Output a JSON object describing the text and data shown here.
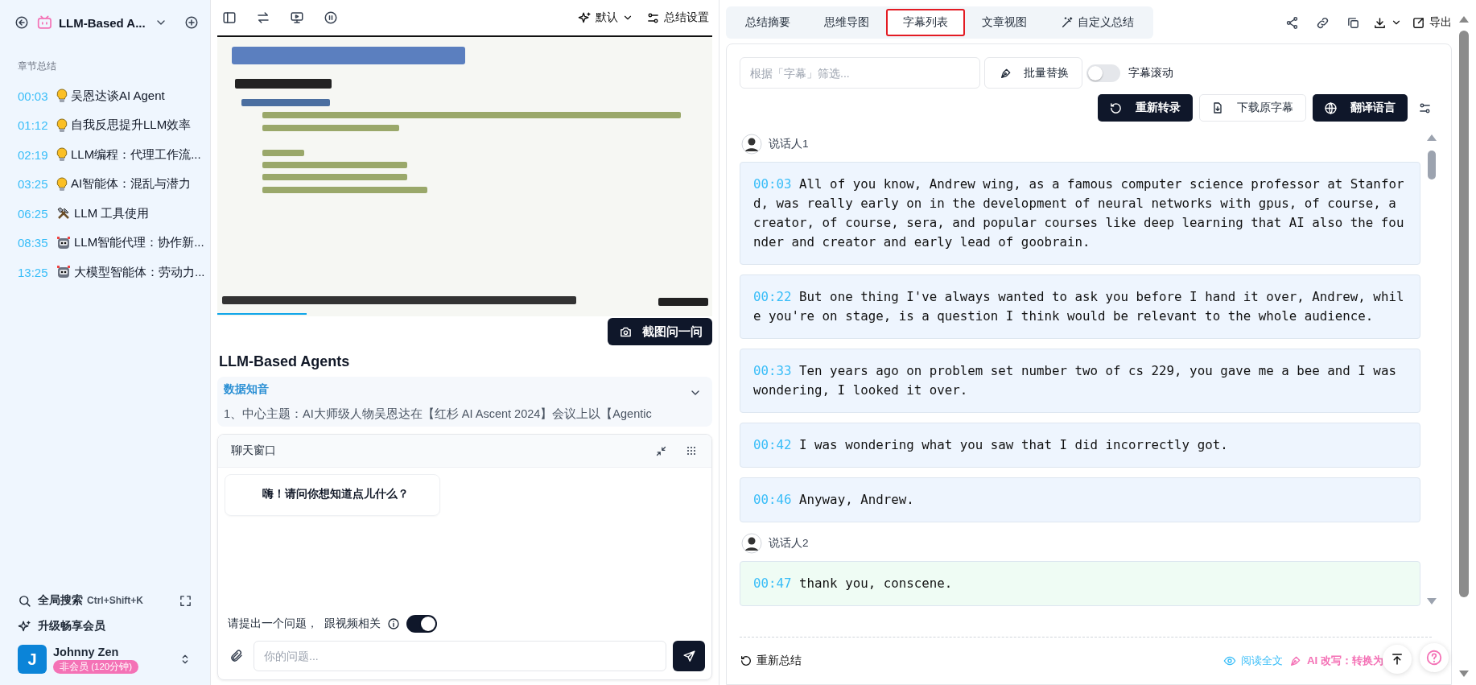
{
  "sidebar": {
    "title": "LLM-Based A...",
    "section_label": "章节总结",
    "chapters": [
      {
        "time": "00:03",
        "kind": "bulb",
        "title": "吴恩达谈AI Agent"
      },
      {
        "time": "01:12",
        "kind": "bulb",
        "title": "自我反思提升LLM效率"
      },
      {
        "time": "02:19",
        "kind": "bulb",
        "title": "LLM编程：代理工作流..."
      },
      {
        "time": "03:25",
        "kind": "bulb",
        "title": "AI智能体：混乱与潜力"
      },
      {
        "time": "06:25",
        "kind": "tools",
        "title": "LLM 工具使用"
      },
      {
        "time": "08:35",
        "kind": "robot",
        "title": "LLM智能代理：协作新..."
      },
      {
        "time": "13:25",
        "kind": "robot",
        "title": "大模型智能体：劳动力..."
      }
    ],
    "search": {
      "label": "全局搜索",
      "shortcut": "Ctrl+Shift+K"
    },
    "upgrade": "升级畅享会员",
    "user": {
      "initial": "J",
      "name": "Johnny Zen",
      "badge": "非会员 (120分钟)"
    }
  },
  "player": {
    "mode": "默认",
    "settings": "总结设置",
    "video": {
      "kind": "picture",
      "level": 0.18
    },
    "screenshot_button": "截图问一问"
  },
  "summary": {
    "title": "LLM-Based Agents",
    "source": "数据知音",
    "text": "1、中心主题：AI大师级人物吴恩达在【红杉 AI Ascent 2024】会议上以【Agentic"
  },
  "chat": {
    "title": "聊天窗口",
    "greeting": "嗨！请问你想知道点儿什么？",
    "hint": "请提出一个问题，",
    "related_label": "跟视频相关",
    "related_on": true,
    "placeholder": "你的问题..."
  },
  "tabs": [
    {
      "label": "总结摘要",
      "kind": "text",
      "selected": false
    },
    {
      "label": "思维导图",
      "kind": "text",
      "selected": false
    },
    {
      "label": "字幕列表",
      "kind": "text",
      "selected": true
    },
    {
      "label": "文章视图",
      "kind": "text",
      "selected": false
    },
    {
      "label": "自定义总结",
      "kind": "tool",
      "selected": false
    }
  ],
  "export_label": "导出",
  "filter": {
    "placeholder": "根据「字幕」筛选...",
    "replace_button": "批量替换",
    "scroll_label": "字幕滚动",
    "scroll_on": false
  },
  "actions": [
    {
      "label": "重新转录",
      "kind": "primary"
    },
    {
      "label": "下载原字幕",
      "kind": "outline"
    },
    {
      "label": "翻译语言",
      "kind": "primary"
    }
  ],
  "transcript": [
    {
      "speaker": "说话人1",
      "color": "#eef5fe",
      "segments": [
        {
          "time": "00:03",
          "text": "All of you know, Andrew wing, as a famous computer science professor at Stanford, was really early on in the development of neural networks with gpus, of course, a creator, of course, sera, and popular courses like deep learning that AI also the founder and creator and early lead of goobrain."
        },
        {
          "time": "00:22",
          "text": "But one thing I've always wanted to ask you before I hand it over, Andrew, while you're on stage, is a question I think would be relevant to the whole audience."
        },
        {
          "time": "00:33",
          "text": "Ten years ago on problem set number two of cs 229, you gave me a bee and I was wondering, I looked it over."
        },
        {
          "time": "00:42",
          "text": "I was wondering what you saw that I did incorrectly got."
        },
        {
          "time": "00:46",
          "text": "Anyway, Andrew."
        }
      ]
    },
    {
      "speaker": "说话人2",
      "color": "#effcf4",
      "segments": [
        {
          "time": "00:47",
          "text": "thank you, conscene."
        }
      ]
    }
  ],
  "footer": {
    "regenerate": "重新总结",
    "read_all": "阅读全文",
    "rewrite": "AI 改写：转换为"
  }
}
